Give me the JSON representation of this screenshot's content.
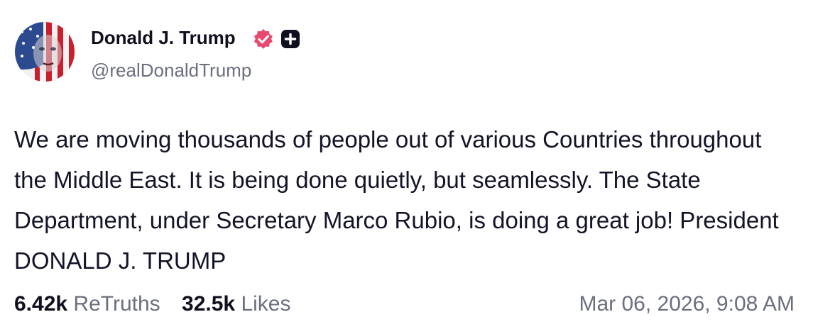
{
  "author": {
    "display_name": "Donald J. Trump",
    "handle": "@realDonaldTrump",
    "verified_icon": "verified-badge-icon",
    "plus_icon": "plus-badge-icon",
    "verified_color": "#e84a6f"
  },
  "post": {
    "text": "We are moving thousands of people out of various Countries throughout the Middle East. It is being done quietly, but seamlessly. The State Department, under Secretary Marco Rubio, is doing a great job! President DONALD J. TRUMP"
  },
  "stats": {
    "retruths_count": "6.42k",
    "retruths_label": "ReTruths",
    "likes_count": "32.5k",
    "likes_label": "Likes",
    "timestamp": "Mar 06, 2026, 9:08 AM"
  }
}
